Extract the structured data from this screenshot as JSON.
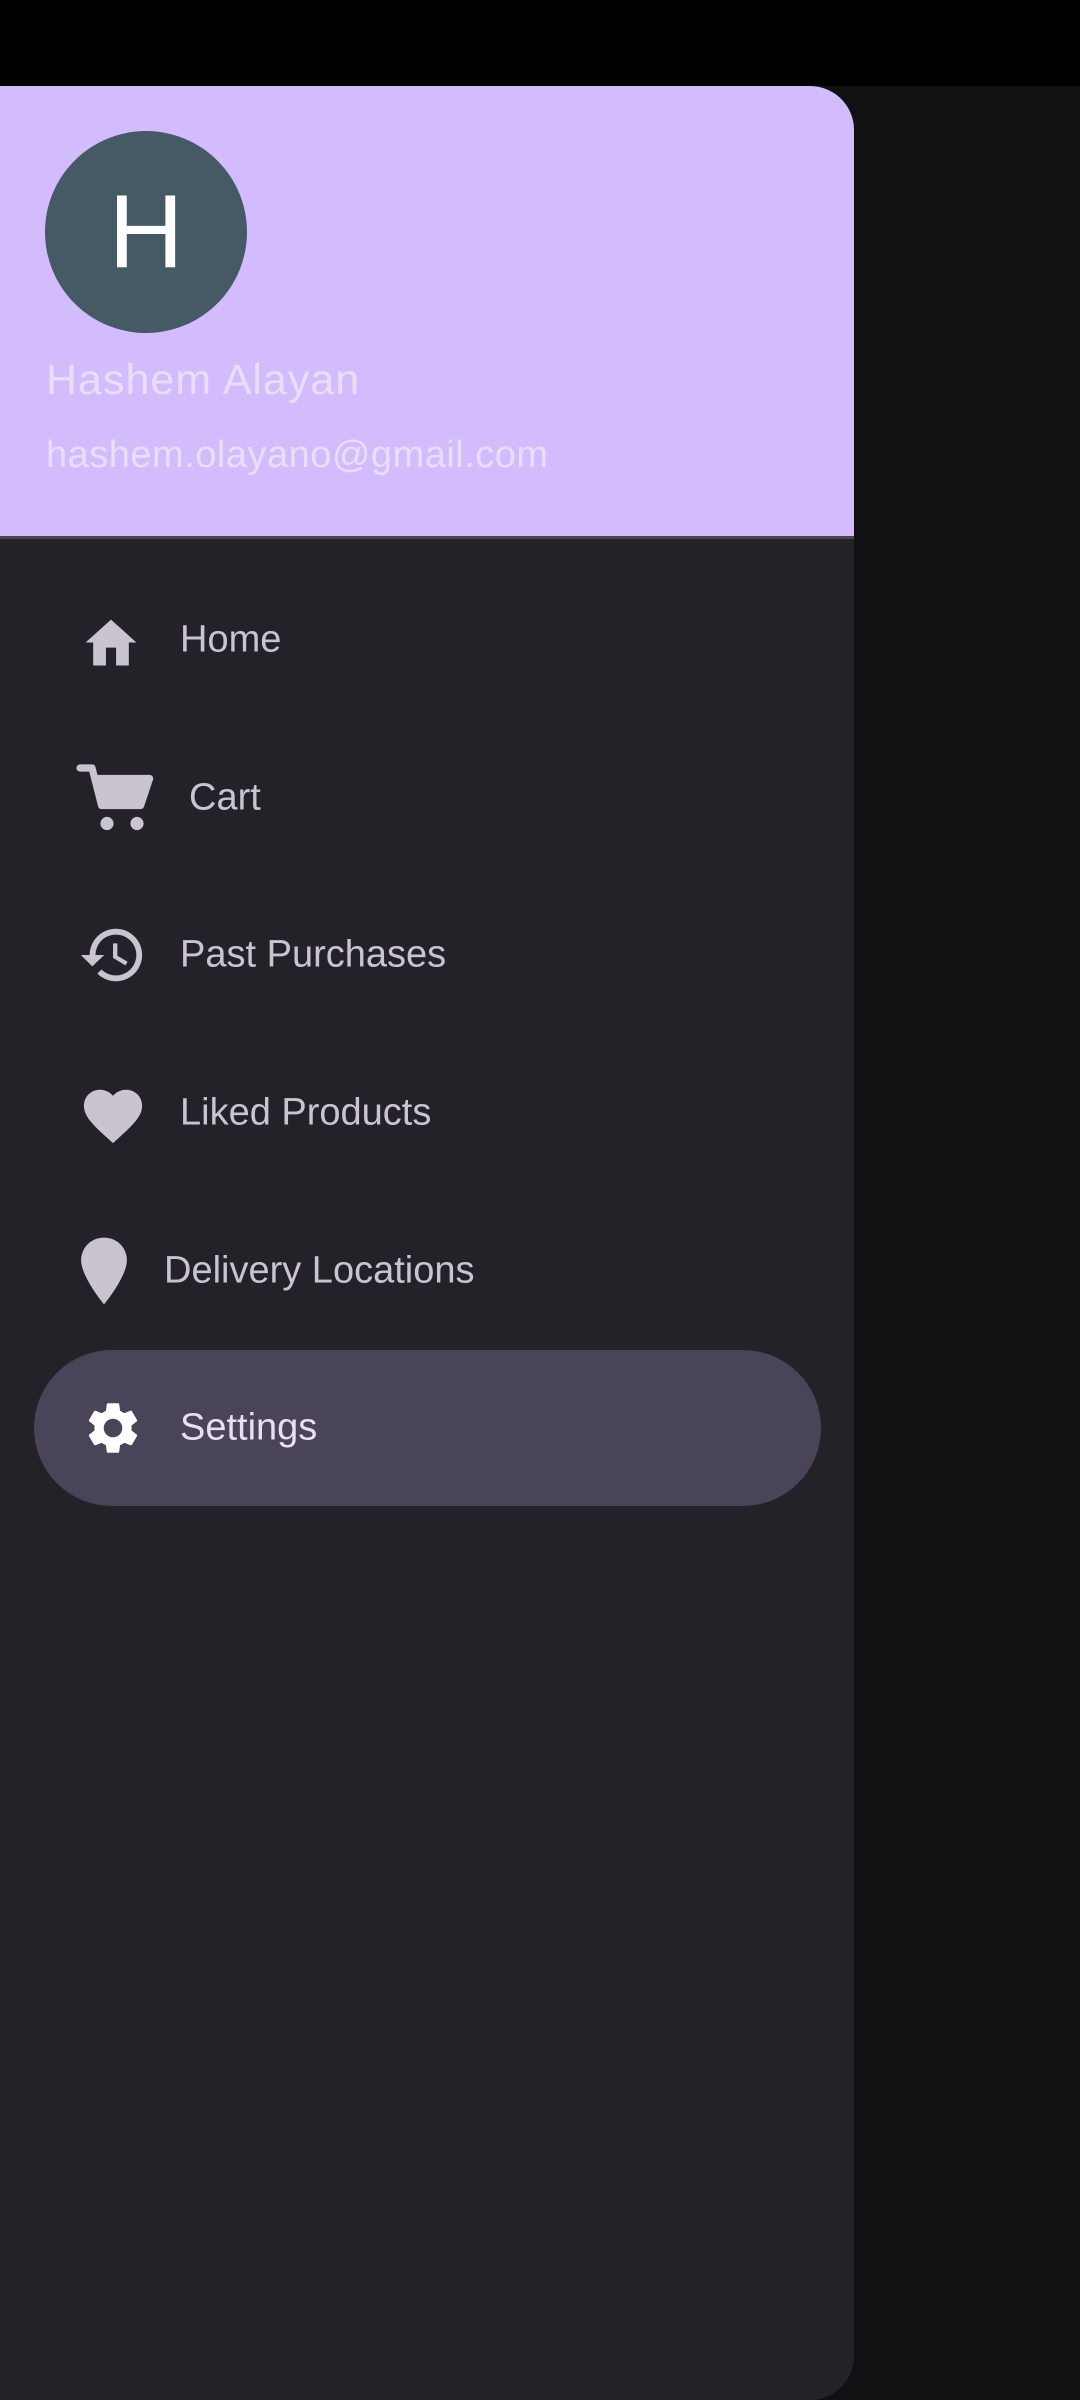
{
  "user": {
    "avatar_initial": "H",
    "name": "Hashem Alayan",
    "email": "hashem.olayano@gmail.com"
  },
  "nav": {
    "items": [
      {
        "label": "Home",
        "icon": "home-icon"
      },
      {
        "label": "Cart",
        "icon": "cart-icon"
      },
      {
        "label": "Past Purchases",
        "icon": "history-icon"
      },
      {
        "label": "Liked Products",
        "icon": "heart-icon"
      },
      {
        "label": "Delivery Locations",
        "icon": "location-pin-icon"
      },
      {
        "label": "Settings",
        "icon": "gear-icon",
        "selected": true
      }
    ]
  },
  "colors": {
    "header_bg": "#d2bcfd",
    "drawer_bg": "#232229",
    "selected_bg": "#4a4458",
    "avatar_bg": "#455a64",
    "icon": "#cac4d0"
  }
}
